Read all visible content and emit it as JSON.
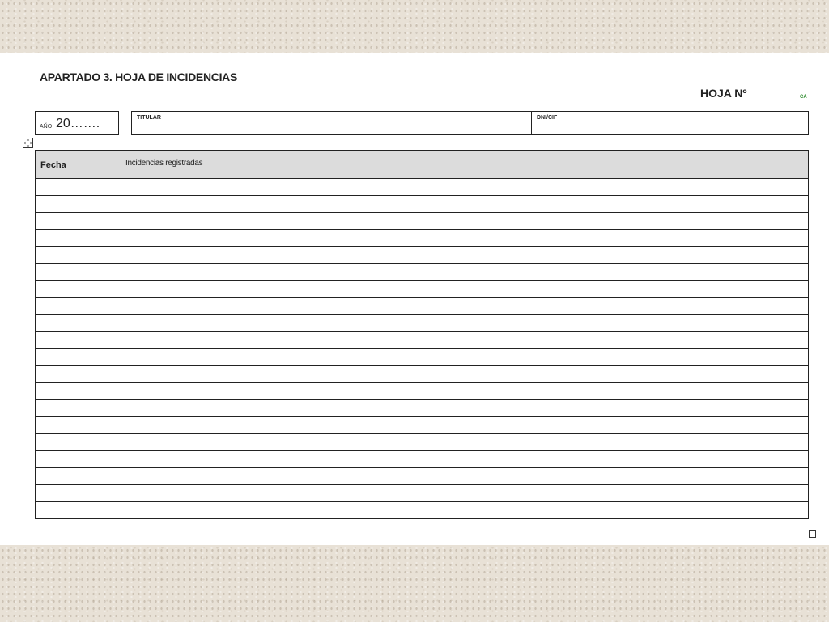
{
  "document": {
    "title": "APARTADO 3. HOJA DE INCIDENCIAS",
    "sheet_label": "HOJA Nº",
    "corner_mark": "CA"
  },
  "header_fields": {
    "year_small_label": "AÑO",
    "year_value": "20…….",
    "holder_label": "TITULAR",
    "id_label": "DNI/CIF"
  },
  "table": {
    "columns": [
      "Fecha",
      "Incidencias registradas"
    ],
    "empty_row_count": 20
  },
  "icons": {
    "table_move_handle": "move-cross-icon",
    "table_resize_handle": "resize-square-icon"
  }
}
